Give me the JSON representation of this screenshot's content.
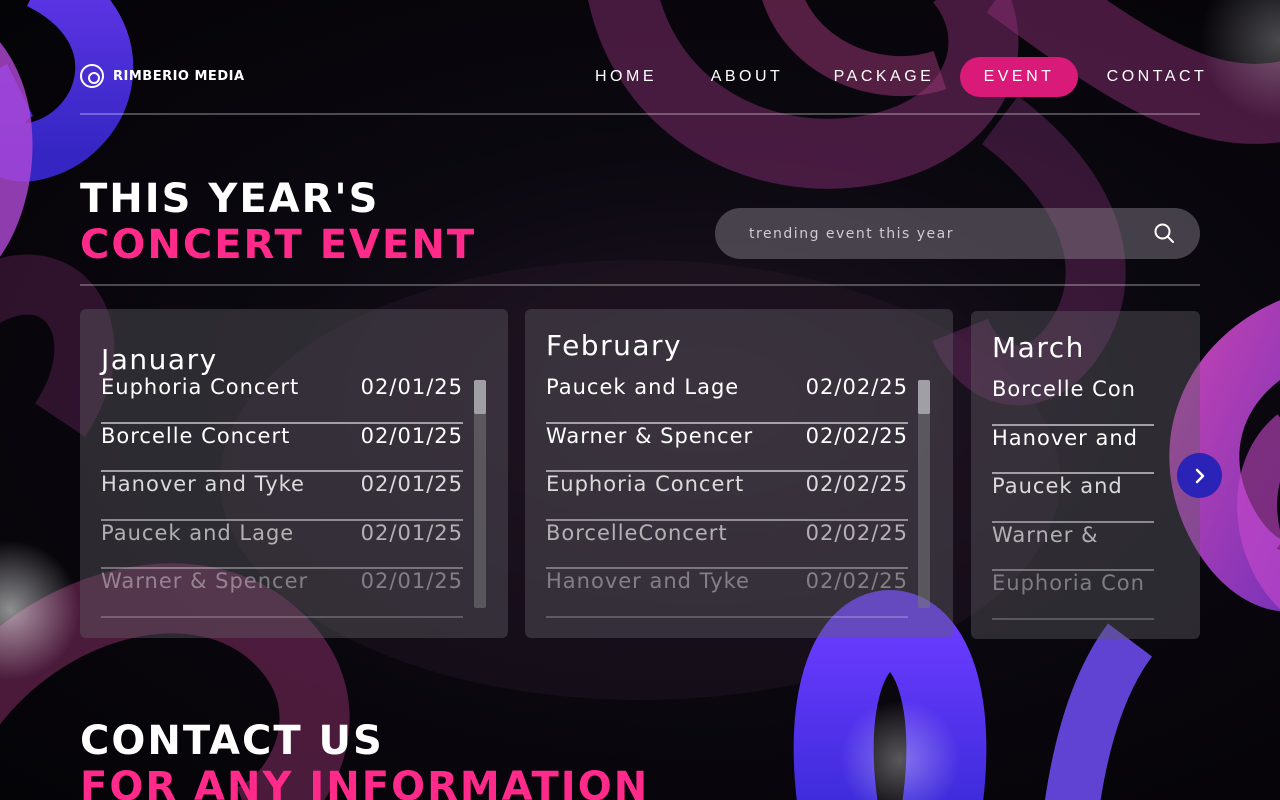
{
  "brand": {
    "name": "RIMBERIO MEDIA"
  },
  "nav": {
    "items": [
      {
        "label": "HOME",
        "active": false
      },
      {
        "label": "ABOUT",
        "active": false
      },
      {
        "label": "PACKAGE",
        "active": false
      },
      {
        "label": "EVENT",
        "active": true
      },
      {
        "label": "CONTACT",
        "active": false
      }
    ],
    "active_color": "#d91a78"
  },
  "hero": {
    "line1": "THIS YEAR'S",
    "line2": "CONCERT EVENT",
    "accent_color": "#ff2a8a"
  },
  "search": {
    "placeholder": "trending event this year",
    "icon": "search-icon"
  },
  "months": [
    {
      "name": "January",
      "events": [
        {
          "name": "Euphoria Concert",
          "date": "02/01/25"
        },
        {
          "name": "Borcelle Concert",
          "date": "02/01/25"
        },
        {
          "name": "Hanover and Tyke",
          "date": "02/01/25"
        },
        {
          "name": "Paucek and Lage",
          "date": "02/01/25"
        },
        {
          "name": "Warner & Spencer",
          "date": "02/01/25"
        }
      ]
    },
    {
      "name": "February",
      "events": [
        {
          "name": "Paucek and Lage",
          "date": "02/02/25"
        },
        {
          "name": "Warner & Spencer",
          "date": "02/02/25"
        },
        {
          "name": "Euphoria Concert",
          "date": "02/02/25"
        },
        {
          "name": "BorcelleConcert",
          "date": "02/02/25"
        },
        {
          "name": "Hanover and Tyke",
          "date": "02/02/25"
        }
      ]
    },
    {
      "name": "March",
      "events": [
        {
          "name": "Borcelle Con"
        },
        {
          "name": "Hanover and"
        },
        {
          "name": "Paucek and"
        },
        {
          "name": "Warner &"
        },
        {
          "name": "Euphoria Con"
        }
      ]
    }
  ],
  "carousel": {
    "next_icon": "chevron-right-icon",
    "button_color": "#2b22b8"
  },
  "contact": {
    "line1": "CONTACT US",
    "line2": "FOR ANY INFORMATION"
  }
}
